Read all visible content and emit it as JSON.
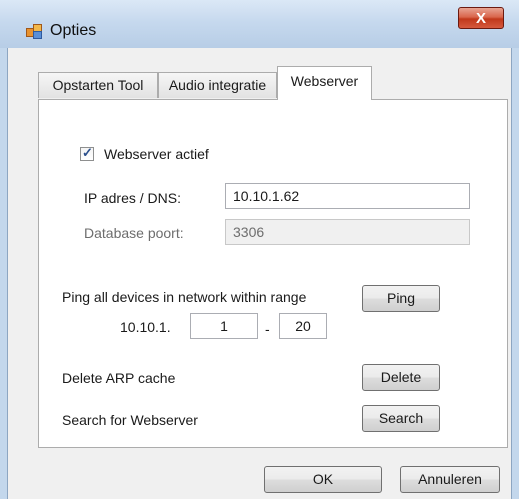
{
  "window": {
    "title": "Opties",
    "close_symbol": "X"
  },
  "tabs": [
    {
      "label": "Opstarten Tool",
      "active": false
    },
    {
      "label": "Audio integratie",
      "active": false
    },
    {
      "label": "Webserver",
      "active": true
    }
  ],
  "webserver": {
    "active_checkbox": {
      "label": "Webserver actief",
      "checked": true,
      "mark": "✓"
    },
    "ip": {
      "label": "IP adres / DNS:",
      "value": "10.10.1.62"
    },
    "db_port": {
      "label": "Database poort:",
      "value": "3306",
      "disabled": true
    },
    "ping": {
      "label": "Ping all devices in network within range",
      "button": "Ping",
      "prefix": "10.10.1.",
      "range_start": "1",
      "range_separator": "-",
      "range_end": "20"
    },
    "arp": {
      "label": "Delete ARP cache",
      "button": "Delete"
    },
    "search": {
      "label": "Search for Webserver",
      "button": "Search"
    }
  },
  "footer": {
    "ok_button": "OK",
    "cancel_button": "Annuleren"
  },
  "colors": {
    "titlebar": "#c6d9ee",
    "close_button": "#c1381b",
    "panel": "#ffffff",
    "dialog": "#f0f0f0"
  }
}
